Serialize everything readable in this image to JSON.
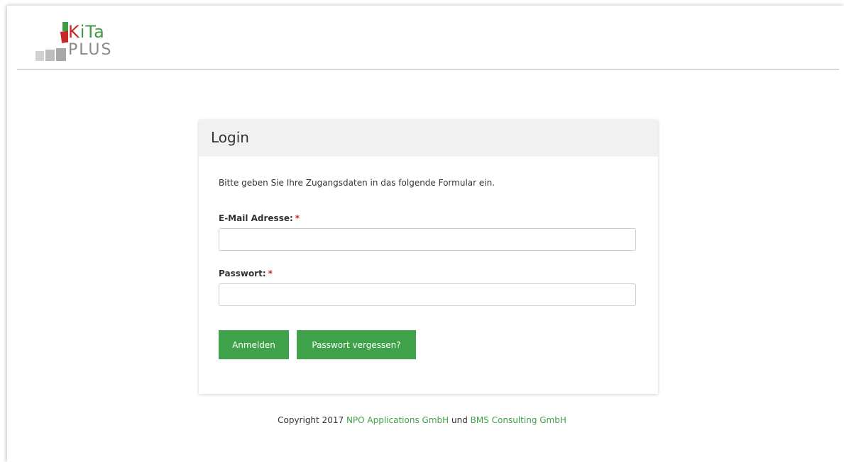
{
  "logo": {
    "line1_k": "K",
    "line1_rest": "iTa",
    "line2": "PLUS"
  },
  "login": {
    "title": "Login",
    "intro": "Bitte geben Sie Ihre Zugangsdaten in das folgende Formular ein.",
    "email_label": "E-Mail Adresse:",
    "email_value": "",
    "password_label": "Passwort:",
    "password_value": "",
    "required_marker": "*",
    "submit_label": "Anmelden",
    "forgot_label": "Passwort vergessen?"
  },
  "footer": {
    "prefix": "Copyright 2017",
    "company1": "NPO Applications GmbH",
    "conjunction": "und",
    "company2": "BMS Consulting GmbH"
  },
  "colors": {
    "accent_green": "#3fa14a",
    "logo_red": "#c62828",
    "logo_gray": "#8a8a8a"
  }
}
